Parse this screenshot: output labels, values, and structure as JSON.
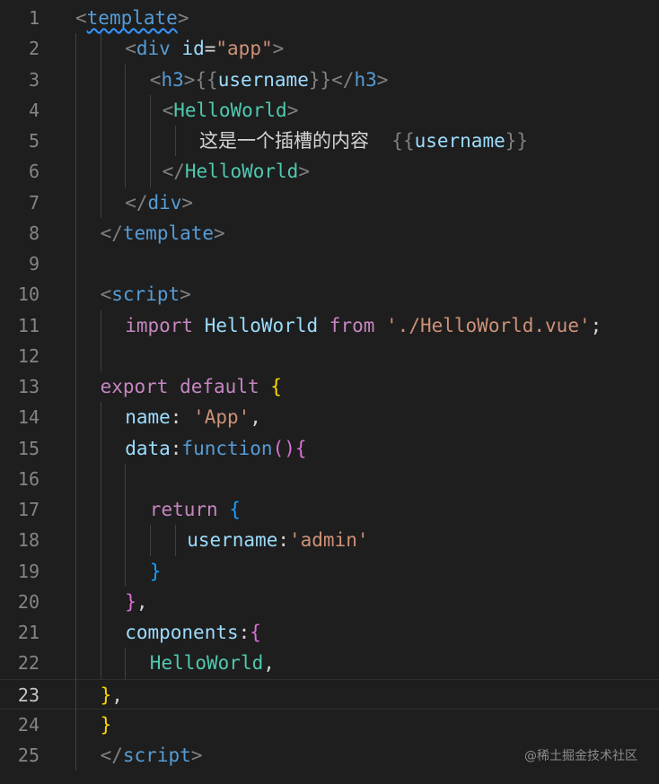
{
  "lines": [
    {
      "n": "1",
      "tokens": [
        [
          "t-p",
          "<"
        ],
        [
          "t-tag squiggle",
          "template"
        ],
        [
          "t-p",
          ">"
        ]
      ],
      "indent": 0
    },
    {
      "n": "2",
      "tokens": [
        [
          "t-p",
          "<"
        ],
        [
          "t-tag",
          "div"
        ],
        [
          "t-text",
          " "
        ],
        [
          "t-attr",
          "id"
        ],
        [
          "t-text",
          "="
        ],
        [
          "t-str",
          "\"app\""
        ],
        [
          "t-p",
          ">"
        ]
      ],
      "indent": 2
    },
    {
      "n": "3",
      "tokens": [
        [
          "t-p",
          "<"
        ],
        [
          "t-tag",
          "h3"
        ],
        [
          "t-p",
          ">"
        ],
        [
          "t-p",
          "{{"
        ],
        [
          "t-id",
          "username"
        ],
        [
          "t-p",
          "}}"
        ],
        [
          "t-p",
          "</"
        ],
        [
          "t-tag",
          "h3"
        ],
        [
          "t-p",
          ">"
        ]
      ],
      "indent": 3
    },
    {
      "n": "4",
      "tokens": [
        [
          "t-p",
          "<"
        ],
        [
          "t-comp",
          "HelloWorld"
        ],
        [
          "t-p",
          ">"
        ]
      ],
      "indent": 3.5
    },
    {
      "n": "5",
      "tokens": [
        [
          "t-text",
          "这是一个插槽的内容  "
        ],
        [
          "t-p",
          "{{"
        ],
        [
          "t-id",
          "username"
        ],
        [
          "t-p",
          "}}"
        ]
      ],
      "indent": 5
    },
    {
      "n": "6",
      "tokens": [
        [
          "t-p",
          "</"
        ],
        [
          "t-comp",
          "HelloWorld"
        ],
        [
          "t-p",
          ">"
        ]
      ],
      "indent": 3.5
    },
    {
      "n": "7",
      "tokens": [
        [
          "t-p",
          "</"
        ],
        [
          "t-tag",
          "div"
        ],
        [
          "t-p",
          ">"
        ]
      ],
      "indent": 2
    },
    {
      "n": "8",
      "tokens": [
        [
          "t-p",
          "</"
        ],
        [
          "t-tag",
          "template"
        ],
        [
          "t-p",
          ">"
        ]
      ],
      "indent": 1
    },
    {
      "n": "9",
      "tokens": [],
      "indent": 0
    },
    {
      "n": "10",
      "tokens": [
        [
          "t-p",
          "<"
        ],
        [
          "t-tag",
          "script"
        ],
        [
          "t-p",
          ">"
        ]
      ],
      "indent": 1
    },
    {
      "n": "11",
      "tokens": [
        [
          "t-kw",
          "import"
        ],
        [
          "t-text",
          " "
        ],
        [
          "t-id",
          "HelloWorld"
        ],
        [
          "t-text",
          " "
        ],
        [
          "t-kw",
          "from"
        ],
        [
          "t-text",
          " "
        ],
        [
          "t-str",
          "'./HelloWorld.vue'"
        ],
        [
          "t-text",
          ";"
        ]
      ],
      "indent": 2
    },
    {
      "n": "12",
      "tokens": [],
      "indent": 0
    },
    {
      "n": "13",
      "tokens": [
        [
          "t-kw",
          "export"
        ],
        [
          "t-text",
          " "
        ],
        [
          "t-kw",
          "default"
        ],
        [
          "t-text",
          " "
        ],
        [
          "t-b1",
          "{"
        ]
      ],
      "indent": 1
    },
    {
      "n": "14",
      "tokens": [
        [
          "t-prop",
          "name"
        ],
        [
          "t-text",
          ": "
        ],
        [
          "t-str",
          "'App'"
        ],
        [
          "t-text",
          ","
        ]
      ],
      "indent": 2
    },
    {
      "n": "15",
      "tokens": [
        [
          "t-prop",
          "data"
        ],
        [
          "t-text",
          ":"
        ],
        [
          "t-fn",
          "function"
        ],
        [
          "t-b2",
          "()"
        ],
        [
          "t-b2",
          "{"
        ]
      ],
      "indent": 2
    },
    {
      "n": "16",
      "tokens": [],
      "indent": 0
    },
    {
      "n": "17",
      "tokens": [
        [
          "t-kw",
          "return"
        ],
        [
          "t-text",
          " "
        ],
        [
          "t-b3",
          "{"
        ]
      ],
      "indent": 3
    },
    {
      "n": "18",
      "tokens": [
        [
          "t-prop",
          "username"
        ],
        [
          "t-text",
          ":"
        ],
        [
          "t-str",
          "'admin'"
        ]
      ],
      "indent": 4.5
    },
    {
      "n": "19",
      "tokens": [
        [
          "t-b3",
          "}"
        ]
      ],
      "indent": 3
    },
    {
      "n": "20",
      "tokens": [
        [
          "t-b2",
          "}"
        ],
        [
          "t-text",
          ","
        ]
      ],
      "indent": 2
    },
    {
      "n": "21",
      "tokens": [
        [
          "t-prop",
          "components"
        ],
        [
          "t-text",
          ":"
        ],
        [
          "t-b2",
          "{"
        ]
      ],
      "indent": 2
    },
    {
      "n": "22",
      "tokens": [
        [
          "t-comp",
          "HelloWorld"
        ],
        [
          "t-text",
          ","
        ]
      ],
      "indent": 3
    },
    {
      "n": "23",
      "tokens": [
        [
          "t-b1",
          "}"
        ],
        [
          "t-text",
          ","
        ]
      ],
      "indent": 1,
      "active": true
    },
    {
      "n": "24",
      "tokens": [
        [
          "t-b1",
          "}"
        ]
      ],
      "indent": 1
    },
    {
      "n": "25",
      "tokens": [
        [
          "t-p",
          "</"
        ],
        [
          "t-tag",
          "script"
        ],
        [
          "t-p",
          ">"
        ]
      ],
      "indent": 1
    }
  ],
  "watermark": "@稀土掘金技术社区"
}
